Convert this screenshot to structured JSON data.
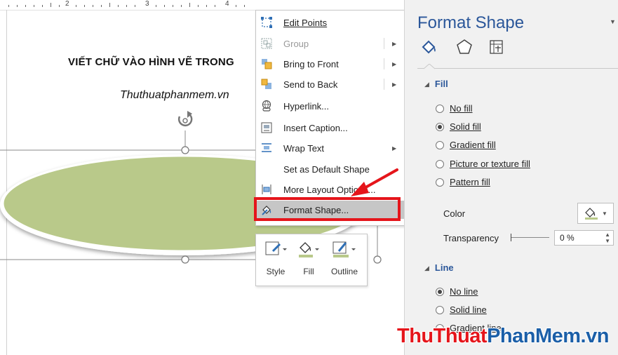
{
  "document": {
    "ruler_numbers": [
      "2",
      "3",
      "4"
    ],
    "title": "VIẾT CHỮ VÀO HÌNH VẼ TRONG",
    "subtitle": "Thuthuatphanmem.vn"
  },
  "context_menu": {
    "items": [
      {
        "label": "Edit Points",
        "icon": "edit-points-icon",
        "enabled": true,
        "submenu": false
      },
      {
        "label": "Group",
        "icon": "group-icon",
        "enabled": false,
        "submenu": true
      },
      {
        "label": "Bring to Front",
        "icon": "bring-to-front-icon",
        "enabled": true,
        "submenu": true
      },
      {
        "label": "Send to Back",
        "icon": "send-to-back-icon",
        "enabled": true,
        "submenu": true
      },
      {
        "label": "Hyperlink...",
        "icon": "hyperlink-icon",
        "enabled": true,
        "submenu": false
      },
      {
        "label": "Insert Caption...",
        "icon": "insert-caption-icon",
        "enabled": true,
        "submenu": false
      },
      {
        "label": "Wrap Text",
        "icon": "wrap-text-icon",
        "enabled": true,
        "submenu": true
      },
      {
        "label": "Set as Default Shape",
        "icon": "",
        "enabled": true,
        "submenu": false
      },
      {
        "label": "More Layout Options...",
        "icon": "more-layout-icon",
        "enabled": true,
        "submenu": false
      },
      {
        "label": "Format Shape...",
        "icon": "format-shape-icon",
        "enabled": true,
        "submenu": false,
        "highlighted": true
      }
    ]
  },
  "mini_toolbar": {
    "style_label": "Style",
    "fill_label": "Fill",
    "outline_label": "Outline"
  },
  "pane": {
    "title": "Format Shape",
    "fill_section": "Fill",
    "fill_options": [
      "No fill",
      "Solid fill",
      "Gradient fill",
      "Picture or texture fill",
      "Pattern fill"
    ],
    "fill_selected": "Solid fill",
    "color_label": "Color",
    "transparency_label": "Transparency",
    "transparency_value": "0 %",
    "line_section": "Line",
    "line_options": [
      "No line",
      "Solid line",
      "Gradient line"
    ],
    "line_selected": "No line"
  },
  "watermark": {
    "part1": "ThuThuat",
    "part2": "PhanMem.vn"
  },
  "colors": {
    "accent_blue": "#2b579a",
    "highlight_red": "#e5151b",
    "shape_fill": "#b9c98a",
    "menu_highlight": "#c6c6c6"
  }
}
